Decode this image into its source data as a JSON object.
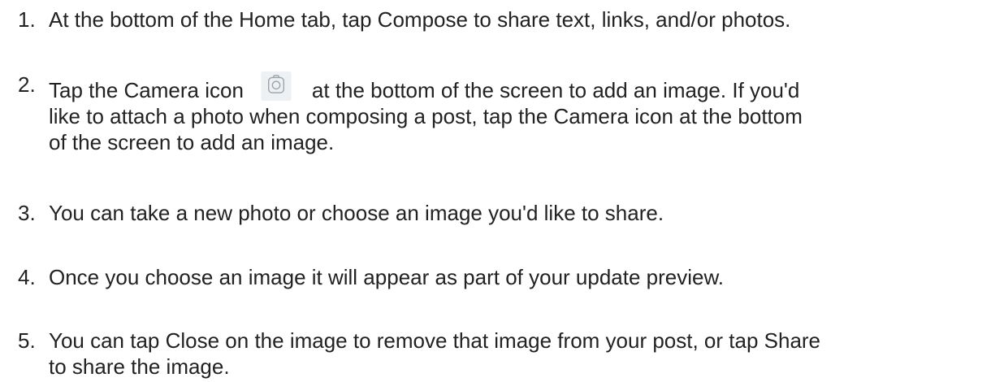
{
  "instructions": {
    "steps": [
      {
        "number": "1.",
        "text": "At the bottom of the Home tab, tap Compose to share text, links, and/or photos."
      },
      {
        "number": "2.",
        "text_before_icon": "Tap the Camera icon",
        "icon": "camera-icon",
        "text_after_icon": "at the bottom of the screen to add an image. If you'd",
        "line2": "like to attach a photo when composing a post, tap the Camera icon at the bottom",
        "line3": "of the screen to add an image."
      },
      {
        "number": "3.",
        "text": "You can take a new photo or choose an image you'd like to share."
      },
      {
        "number": "4.",
        "text": "Once you choose an image it will appear as part of your update preview."
      },
      {
        "number": "5.",
        "line1": "You can tap Close on the image to remove that image from your post, or tap Share",
        "line2": "to share the image."
      }
    ],
    "colors": {
      "text": "#222222",
      "icon_background": "#eef1f3",
      "icon_stroke": "#9aa3a8"
    }
  }
}
